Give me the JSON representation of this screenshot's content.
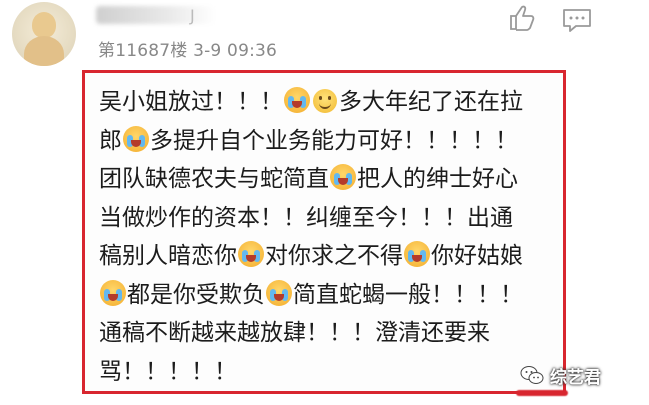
{
  "comment": {
    "meta": "第11687楼 3-9 09:36",
    "username_tail": "J",
    "lines": [
      [
        "吴小姐放过！！！",
        "emoji-cry",
        "emoji-smile",
        "多大年纪了还在拉"
      ],
      [
        "郎",
        "emoji-cry",
        "多提升自个业务能力可好！！！！！"
      ],
      [
        "团队缺德农夫与蛇简直",
        "emoji-cry",
        "把人的绅士好心"
      ],
      [
        "当做炒作的资本！！纠缠至今！！！出通"
      ],
      [
        "稿别人暗恋你",
        "emoji-cry",
        "对你求之不得",
        "emoji-cry",
        "你好姑娘"
      ],
      [
        "emoji-cry",
        "都是你受欺负",
        "emoji-cry",
        "简直蛇蝎一般！！！！"
      ],
      [
        "通稿不断越来越放肆！！！澄清还要来"
      ],
      [
        "骂！！！！！"
      ]
    ],
    "line_1": {
      "t1": "吴小姐放过！！！",
      "t2": "多大年纪了还在拉"
    },
    "line_2": {
      "t1": "郎",
      "t2": "多提升自个业务能力可好！！！！！"
    },
    "line_3": {
      "t1": "团队缺德农夫与蛇简直",
      "t2": "把人的绅士好心"
    },
    "line_4": {
      "t1": "当做炒作的资本！！纠缠至今！！！出通"
    },
    "line_5": {
      "t1": "稿别人暗恋你",
      "t2": "对你求之不得",
      "t3": "你好姑娘"
    },
    "line_6": {
      "t1": "都是你受欺负",
      "t2": "简直蛇蝎一般！！！！"
    },
    "line_7": {
      "t1": "通稿不断越来越放肆！！！澄清还要来"
    },
    "line_8": {
      "t1": "骂！！！！！"
    }
  },
  "actions": {
    "like_icon": "thumbs-up-icon",
    "comment_icon": "comment-icon"
  },
  "watermark": {
    "text": "综艺君"
  },
  "colors": {
    "highlight_border": "#d8262f",
    "meta_text": "#888888"
  }
}
